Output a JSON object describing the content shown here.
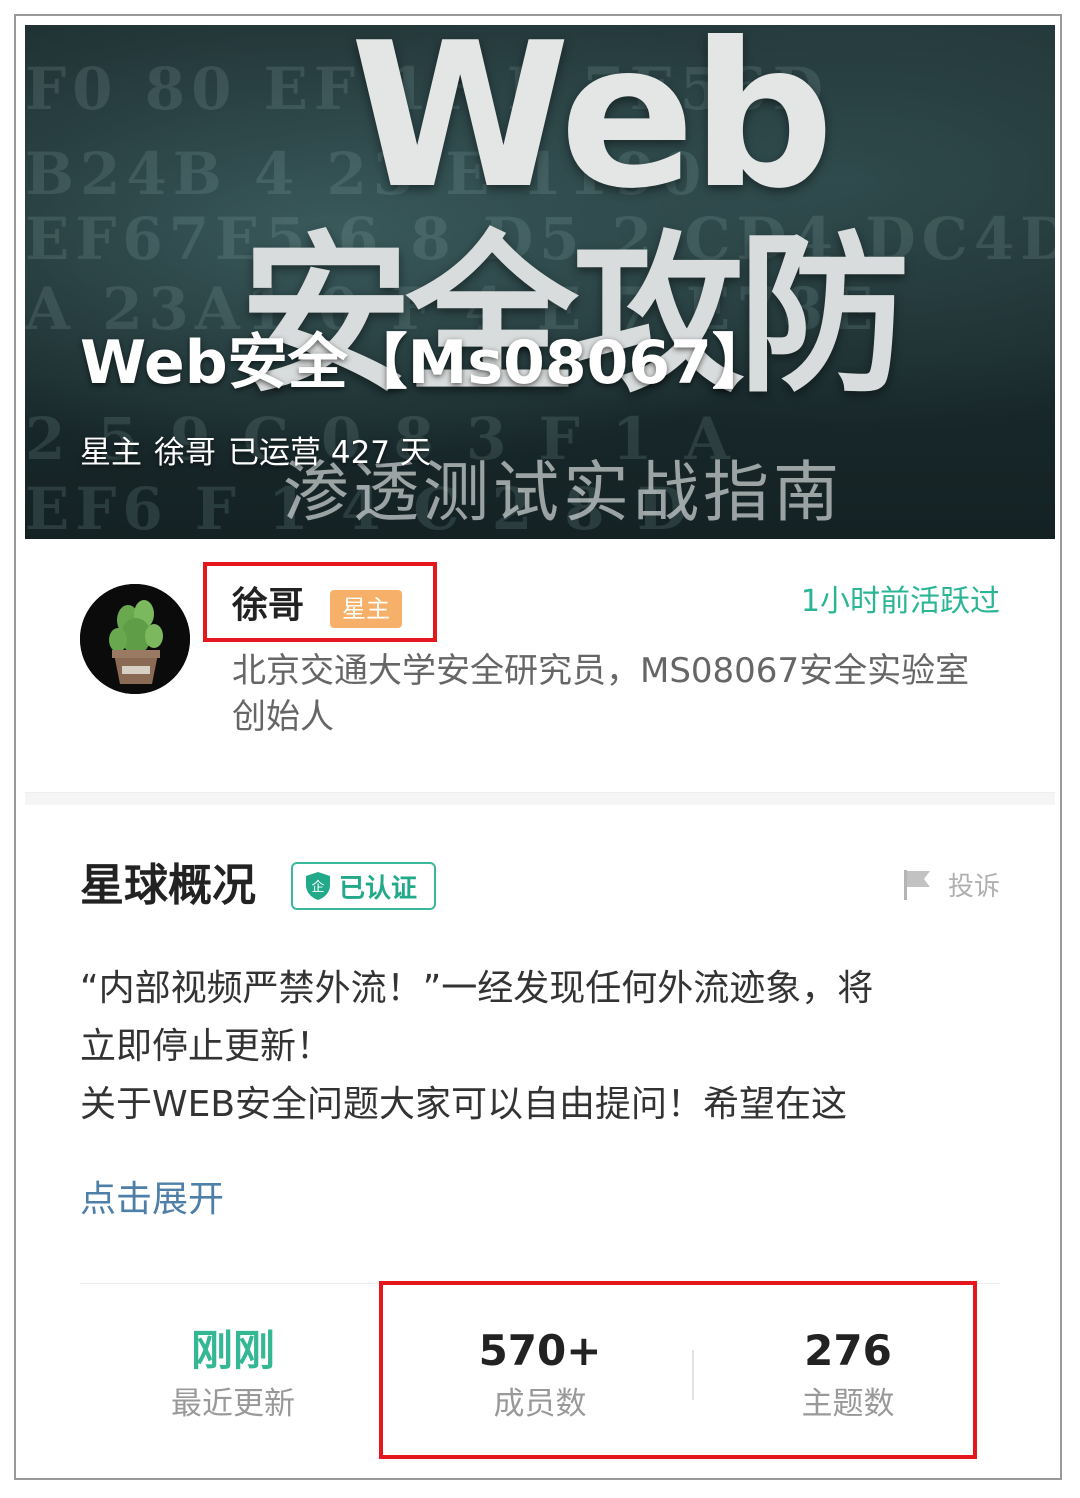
{
  "banner": {
    "art_web": "Web",
    "art_cn": "安全攻防",
    "art_sub": "渗透测试实战指南",
    "hex_rows": [
      "F0 80 EF 1F E 7E56D",
      "B24B 4 23 E 1190",
      "EF67E5 6 8 D5 2 CD4 DC4D",
      "A 23A1 0 F 4 E 7 E78E",
      "2 5 9 C 0 8 3 F 1 A",
      "EF6 F 1 4 C 2 8 D"
    ],
    "title": "Web安全【Ms08067】",
    "owner_prefix": "星主",
    "owner_name": "徐哥",
    "days_text": "已运营 427 天"
  },
  "owner": {
    "name": "徐哥",
    "badge": "星主",
    "active": "1小时前活跃过",
    "desc": "北京交通大学安全研究员，MS08067安全实验室创始人"
  },
  "overview": {
    "title": "星球概况",
    "verified": "已认证",
    "verified_icon_char": "企",
    "report": "投诉",
    "desc_lines": [
      "“内部视频严禁外流！”一经发现任何外流迹象，将",
      "立即停止更新！",
      "关于WEB安全问题大家可以自由提问！希望在这"
    ],
    "expand": "点击展开"
  },
  "stats": {
    "updated": {
      "value": "刚刚",
      "label": "最近更新"
    },
    "members": {
      "value": "570+",
      "label": "成员数"
    },
    "topics": {
      "value": "276",
      "label": "主题数"
    }
  },
  "colors": {
    "accent_green": "#2ab594",
    "badge_orange": "#f7b06a",
    "link_blue": "#4e7fa8",
    "highlight_red": "#e5171d"
  }
}
